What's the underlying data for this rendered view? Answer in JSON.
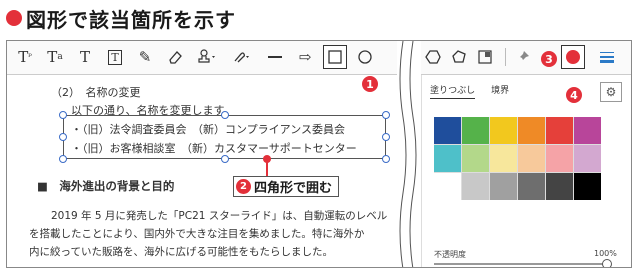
{
  "title": {
    "text": "図形で該当箇所を示す"
  },
  "toolbar": {
    "tools": [
      {
        "name": "text-box-tool-icon",
        "glyph": "T꜈"
      },
      {
        "name": "text-strike-tool-icon",
        "glyph": "Tₐ"
      },
      {
        "name": "text-tool-icon",
        "glyph": "T"
      },
      {
        "name": "text-frame-tool-icon",
        "glyph": "🅃"
      },
      {
        "name": "pencil-tool-icon",
        "glyph": "✎"
      },
      {
        "name": "eraser-tool-icon",
        "glyph": "⌫"
      },
      {
        "name": "stamp-tool-icon",
        "glyph": "♙"
      },
      {
        "name": "attach-tool-icon",
        "glyph": "⌘"
      },
      {
        "name": "line-tool-icon",
        "glyph": "—"
      },
      {
        "name": "arrow-tool-icon",
        "glyph": "⇨"
      },
      {
        "name": "rectangle-tool-icon",
        "glyph": "□"
      }
    ]
  },
  "badges": {
    "b1": "1",
    "b2": "2",
    "b3": "3",
    "b4": "4"
  },
  "document": {
    "lines": [
      "（2）　名称の変更",
      "以下の通り、名称を変更します。",
      "・（旧）法令調査委員会　（新）コンプライアンス委員会",
      "・（旧）お客様相談室　（新）カスタマーサポートセンター",
      "■　海外進出の背景と目的",
      "2019 年 5 月に発売した「PC21 スターライド」は、自動運転のレベル",
      "を搭載したことにより、国内外で大きな注目を集めました。特に海外か",
      "内に絞っていた販路を、海外に広げる可能性をもたらしました。"
    ]
  },
  "callout": {
    "number": "2",
    "text": "四角形で囲む"
  },
  "panel": {
    "tab_fill": "塗りつぶし",
    "tab_border": "境界",
    "opacity_label": "不透明度",
    "opacity_value": "100%",
    "opacity_level": 1.0,
    "swatches": [
      "#1f4e9c",
      "#55b24a",
      "#f2c81e",
      "#ef8a26",
      "#e5403a",
      "#b8459a",
      "#4ec0c9",
      "#b3d88a",
      "#f7e79c",
      "#f7c99b",
      "#f5a3a7",
      "#d3a8d0",
      "#ffffff",
      "#c8c8c8",
      "#a0a0a0",
      "#6e6e6e",
      "#444444",
      "#000000"
    ]
  },
  "colors": {
    "accent": "#e3303a",
    "handle": "#3b6cc7"
  }
}
